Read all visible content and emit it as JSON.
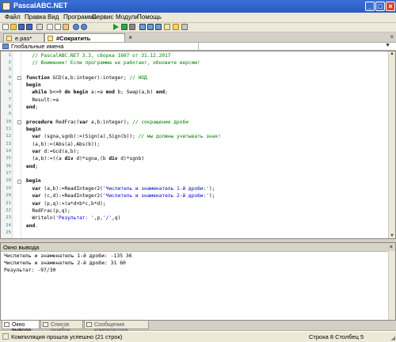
{
  "window": {
    "title": "PascalABC.NET"
  },
  "menu": [
    "Файл",
    "Правка",
    "Вид",
    "Программа",
    "Сервис",
    "Модули",
    "Помощь"
  ],
  "toolbar": {
    "icons": [
      "new-file-icon",
      "open-folder-icon",
      "save-icon",
      "save-all-icon",
      "print-icon",
      "cut-icon",
      "copy-icon",
      "paste-icon",
      "undo-icon",
      "redo-icon",
      "run-icon",
      "debug-run-icon",
      "stop-icon",
      "step-over-icon",
      "step-into-icon",
      "step-out-icon",
      "format-code-icon",
      "output-window-icon",
      "settings-icon"
    ]
  },
  "tabs": [
    {
      "label": "e.pas*",
      "active": false
    },
    {
      "label": "#Сократить дробь.pas*",
      "active": true
    }
  ],
  "scope_label": "Глобальные имена",
  "code": [
    {
      "n": "1",
      "fold": false,
      "hl": false,
      "parts": [
        [
          "cm",
          "  // PascalABC.NET 3.3, сборка 1607 от 31.12.2017"
        ]
      ]
    },
    {
      "n": "2",
      "fold": false,
      "hl": false,
      "parts": [
        [
          "cm",
          "  // Внимание! Если программа не работает, обновите версию!"
        ]
      ]
    },
    {
      "n": "3",
      "fold": false,
      "hl": false,
      "parts": []
    },
    {
      "n": "4",
      "fold": true,
      "hl": false,
      "parts": [
        [
          "kw",
          "function"
        ],
        [
          "tx",
          " GCD(a,b:integer):integer; "
        ],
        [
          "cm",
          "// НОД"
        ]
      ]
    },
    {
      "n": "5",
      "fold": false,
      "hl": false,
      "parts": [
        [
          "kw",
          "begin"
        ]
      ]
    },
    {
      "n": "6",
      "fold": false,
      "hl": false,
      "parts": [
        [
          "tx",
          "  "
        ],
        [
          "kw",
          "while"
        ],
        [
          "tx",
          " b<>0 "
        ],
        [
          "kw",
          "do begin"
        ],
        [
          "tx",
          " a:=a "
        ],
        [
          "kw",
          "mod"
        ],
        [
          "tx",
          " b; Swap(a,b) "
        ],
        [
          "kw",
          "end"
        ],
        [
          "tx",
          ";"
        ]
      ]
    },
    {
      "n": "7",
      "fold": false,
      "hl": false,
      "parts": [
        [
          "tx",
          "  Result:=a"
        ]
      ]
    },
    {
      "n": "8",
      "fold": false,
      "hl": false,
      "parts": [
        [
          "kw",
          "end"
        ],
        [
          "tx",
          ";"
        ]
      ]
    },
    {
      "n": "9",
      "fold": false,
      "hl": false,
      "parts": []
    },
    {
      "n": "10",
      "fold": true,
      "hl": false,
      "parts": [
        [
          "kw",
          "procedure"
        ],
        [
          "tx",
          " RedFrac("
        ],
        [
          "kw",
          "var"
        ],
        [
          "tx",
          " a,b:integer); "
        ],
        [
          "cm",
          "// сокращение дроби"
        ]
      ]
    },
    {
      "n": "11",
      "fold": false,
      "hl": false,
      "parts": [
        [
          "kw",
          "begin"
        ]
      ]
    },
    {
      "n": "12",
      "fold": false,
      "hl": false,
      "parts": [
        [
          "tx",
          "  "
        ],
        [
          "kw",
          "var"
        ],
        [
          "tx",
          " (sgna,sgnb):=(Sign(a),Sign(b)); "
        ],
        [
          "cm",
          "// мы должны учитывать знак!"
        ]
      ]
    },
    {
      "n": "13",
      "fold": false,
      "hl": false,
      "parts": [
        [
          "tx",
          "  (a,b):=(Abs(a),Abs(b));"
        ]
      ]
    },
    {
      "n": "14",
      "fold": false,
      "hl": false,
      "parts": [
        [
          "tx",
          "  "
        ],
        [
          "kw",
          "var"
        ],
        [
          "tx",
          " d:=Gcd(a,b);"
        ]
      ]
    },
    {
      "n": "15",
      "fold": false,
      "hl": false,
      "parts": [
        [
          "tx",
          "  (a,b):=((a "
        ],
        [
          "kw",
          "div"
        ],
        [
          "tx",
          " d)*sgna,(b "
        ],
        [
          "kw",
          "div"
        ],
        [
          "tx",
          " d)*sgnb)"
        ]
      ]
    },
    {
      "n": "16",
      "fold": false,
      "hl": false,
      "parts": [
        [
          "kw",
          "end"
        ],
        [
          "tx",
          ";"
        ]
      ]
    },
    {
      "n": "17",
      "fold": false,
      "hl": false,
      "parts": []
    },
    {
      "n": "18",
      "fold": true,
      "hl": false,
      "parts": [
        [
          "kw",
          "begin"
        ]
      ]
    },
    {
      "n": "19",
      "fold": false,
      "hl": false,
      "parts": [
        [
          "tx",
          "  "
        ],
        [
          "kw",
          "var"
        ],
        [
          "tx",
          " (a,b):=ReadInteger2("
        ],
        [
          "st",
          "'Числитель и знаменатель 1-й дроби:'"
        ],
        [
          "tx",
          ");"
        ]
      ]
    },
    {
      "n": "20",
      "fold": false,
      "hl": false,
      "parts": [
        [
          "tx",
          "  "
        ],
        [
          "kw",
          "var"
        ],
        [
          "tx",
          " (c,d):=ReadInteger2("
        ],
        [
          "st",
          "'Числитель и знаменатель 2-й дроби:'"
        ],
        [
          "tx",
          ");"
        ]
      ]
    },
    {
      "n": "21",
      "fold": false,
      "hl": false,
      "parts": [
        [
          "tx",
          "  "
        ],
        [
          "kw",
          "var"
        ],
        [
          "tx",
          " (p,q):=(a*d+b*c,b*d);"
        ]
      ]
    },
    {
      "n": "22",
      "fold": false,
      "hl": false,
      "parts": [
        [
          "tx",
          "  RedFrac(p,q);"
        ]
      ]
    },
    {
      "n": "23",
      "fold": false,
      "hl": false,
      "parts": [
        [
          "tx",
          "  Writeln("
        ],
        [
          "st",
          "'Результат: '"
        ],
        [
          "tx",
          ",p,"
        ],
        [
          "st",
          "'/'"
        ],
        [
          "tx",
          ",q)"
        ]
      ]
    },
    {
      "n": "24",
      "fold": false,
      "hl": false,
      "parts": [
        [
          "kw",
          "end"
        ],
        [
          "tx",
          "."
        ]
      ]
    },
    {
      "n": "25",
      "fold": false,
      "hl": false,
      "parts": []
    }
  ],
  "output": {
    "title": "Окно вывода",
    "lines": [
      "Числитель и знаменатель 1-й дроби: -135 36",
      "Числитель и знаменатель 2-й дроби: 31 60",
      "Результат: -97/30"
    ]
  },
  "bottom_tabs": [
    {
      "label": "Окно вывода",
      "active": true
    },
    {
      "label": "Список ошибок",
      "active": false
    },
    {
      "label": "Сообщения компилятора",
      "active": false
    }
  ],
  "status": {
    "message": "Компиляция прошла успешно (21 строк)",
    "position": "Строка  8   Столбец  5"
  }
}
